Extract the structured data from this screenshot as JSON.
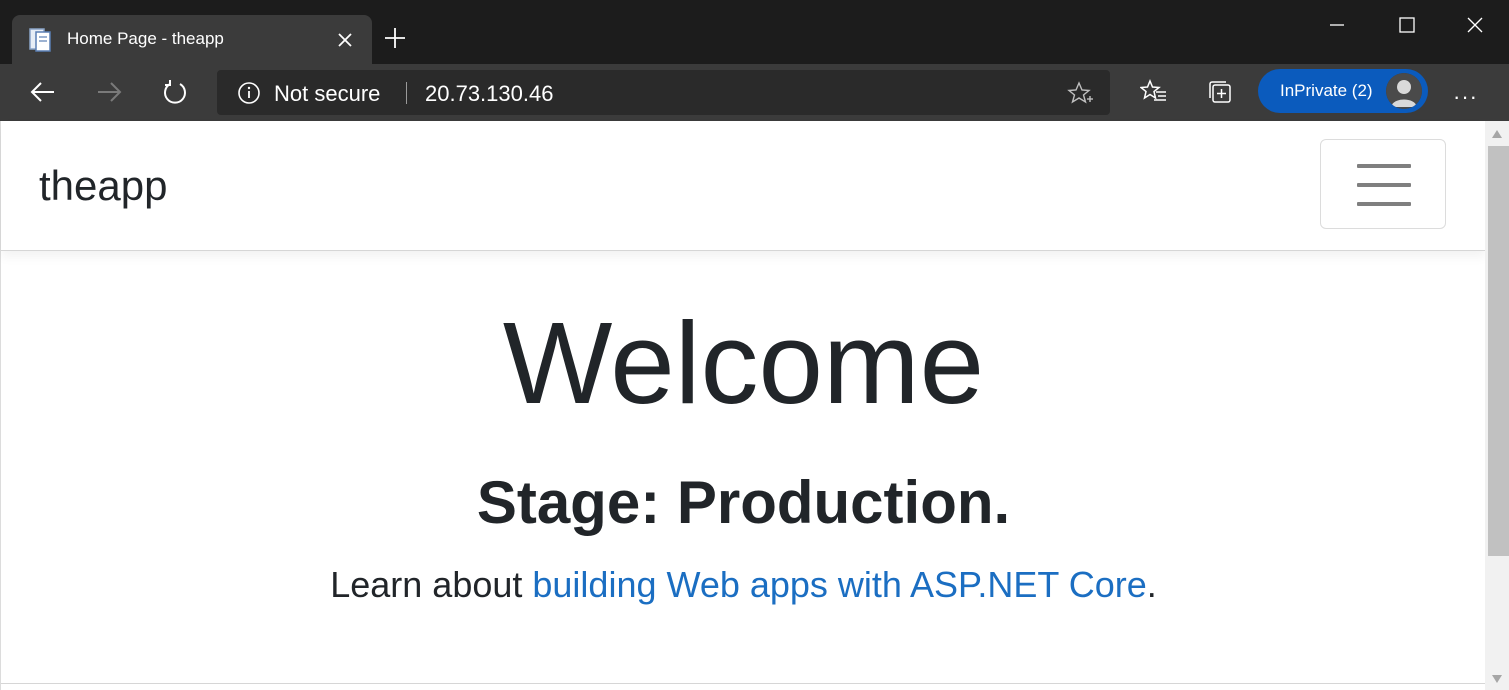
{
  "browser": {
    "tab_title": "Home Page - theapp",
    "security_label": "Not secure",
    "url": "20.73.130.46",
    "inprivate_label": "InPrivate (2)",
    "more_label": "···"
  },
  "page": {
    "brand": "theapp",
    "heading": "Welcome",
    "stage": "Stage: Production.",
    "learn_prefix": "Learn about ",
    "learn_link": "building Web apps with ASP.NET Core",
    "learn_suffix": "."
  },
  "colors": {
    "chrome_dark": "#1c1c1c",
    "toolbar": "#3b3b3b",
    "inprivate_blue": "#0b5bbd",
    "link_blue": "#1b6ec2",
    "text": "#212529"
  },
  "icons": {
    "tab_favicon": "page-icon",
    "tab_close": "close-icon",
    "new_tab": "plus-icon",
    "minimize": "minimize-icon",
    "maximize": "maximize-icon",
    "close_window": "close-icon",
    "back": "arrow-left-icon",
    "forward": "arrow-right-icon",
    "refresh": "refresh-icon",
    "site_info": "info-icon",
    "favorite": "star-add-icon",
    "favorites": "favorites-icon",
    "collections": "collections-icon",
    "menu": "hamburger-icon"
  }
}
